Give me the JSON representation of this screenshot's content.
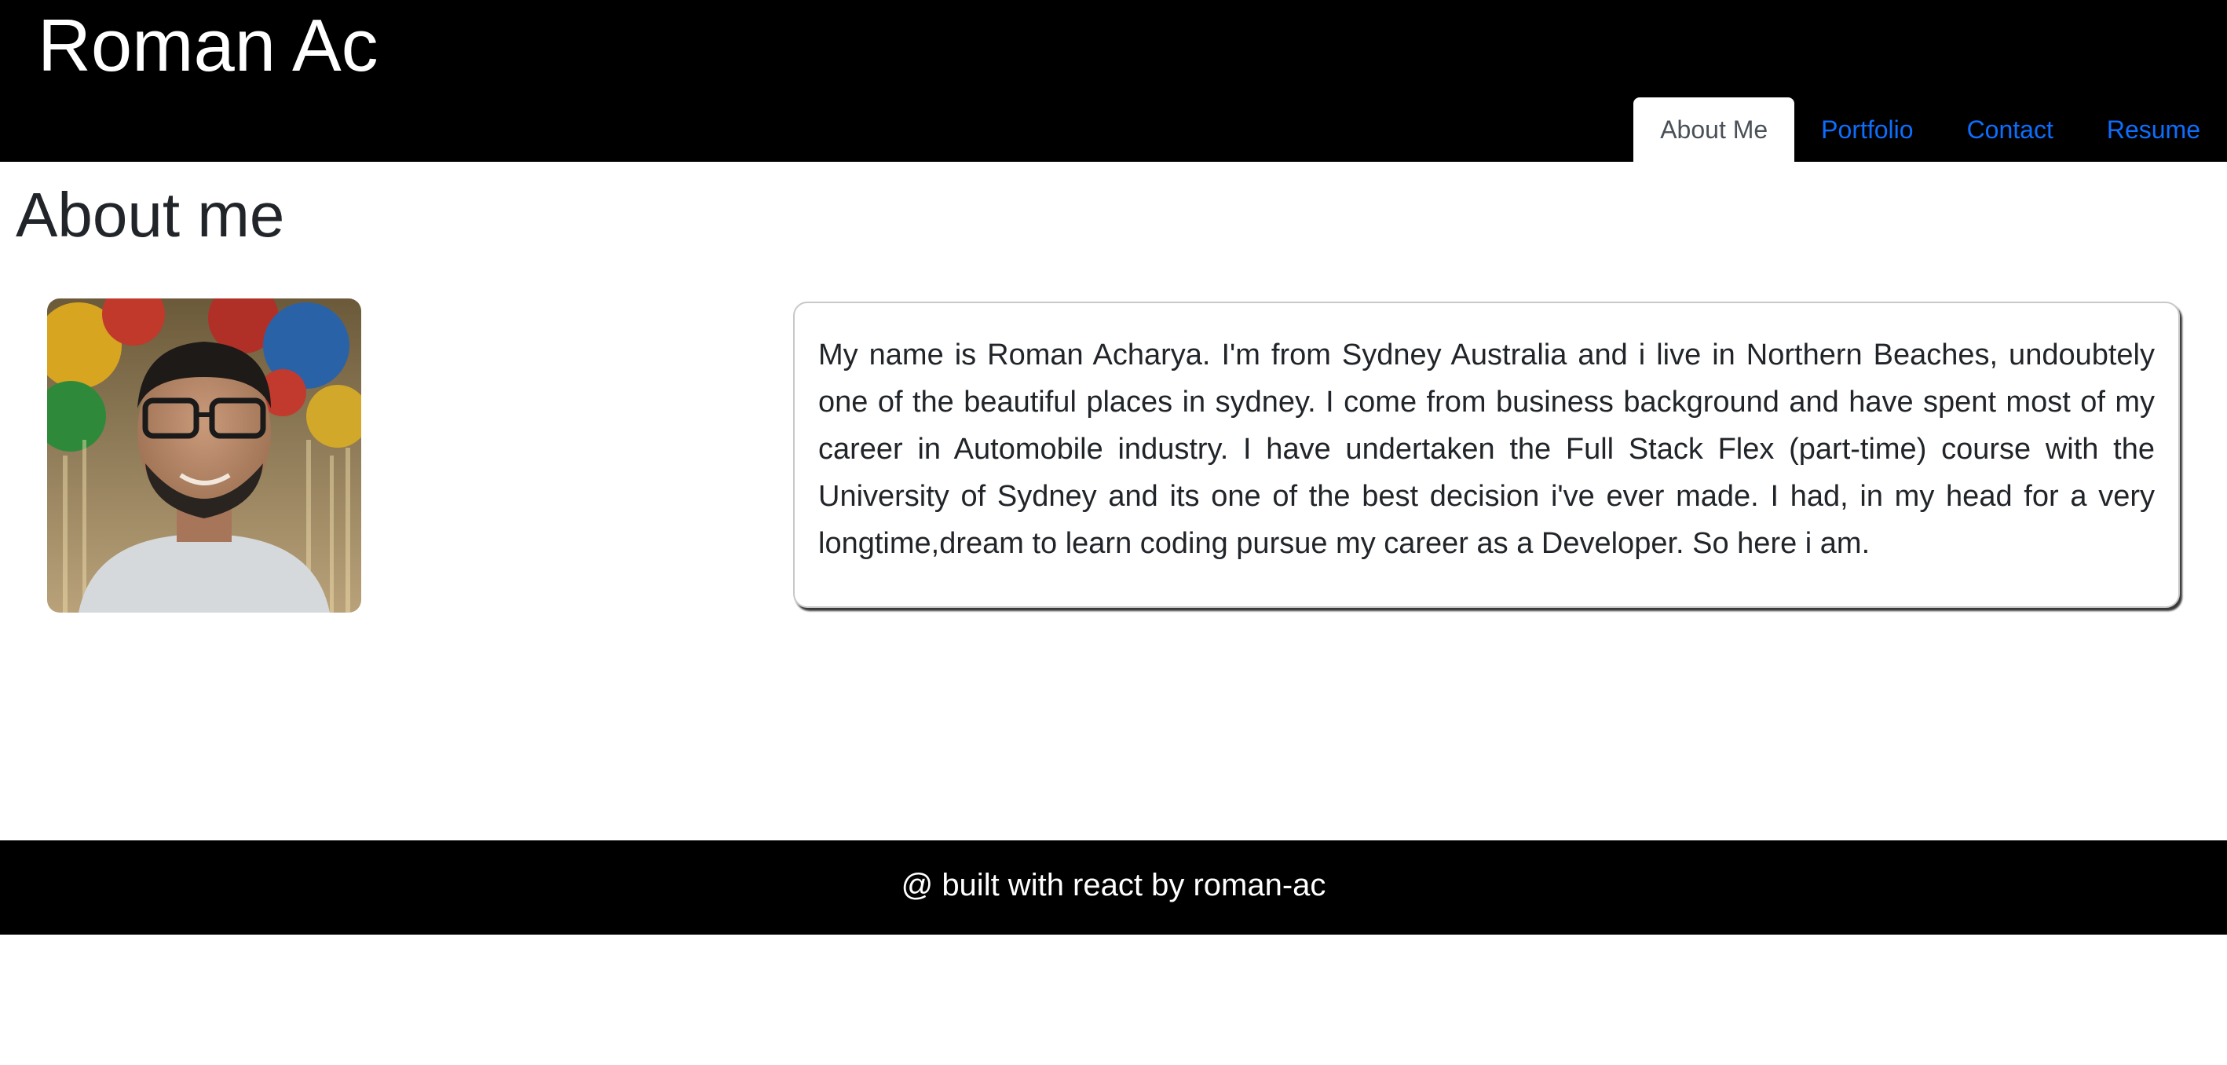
{
  "header": {
    "site_title": "Roman Ac",
    "nav": [
      {
        "label": "About Me",
        "active": true
      },
      {
        "label": "Portfolio",
        "active": false
      },
      {
        "label": "Contact",
        "active": false
      },
      {
        "label": "Resume",
        "active": false
      }
    ]
  },
  "main": {
    "heading": "About me",
    "profile_photo_icon": "profile-photo",
    "bio": "My name is Roman Acharya. I'm from Sydney Australia and i live in Northern Beaches, undoubtely one of the beautiful places in sydney. I come from business background and have spent most of my career in Automobile industry. I have undertaken the Full Stack Flex (part-time) course with the University of Sydney and its one of the best decision i've ever made. I had, in my head for a very longtime,dream to learn coding pursue my career as a Developer. So here i am."
  },
  "footer": {
    "text": "@ built with react by roman-ac"
  },
  "colors": {
    "header_bg": "#000000",
    "link": "#0d6efd",
    "active_tab_text": "#495057",
    "text": "#212529"
  }
}
